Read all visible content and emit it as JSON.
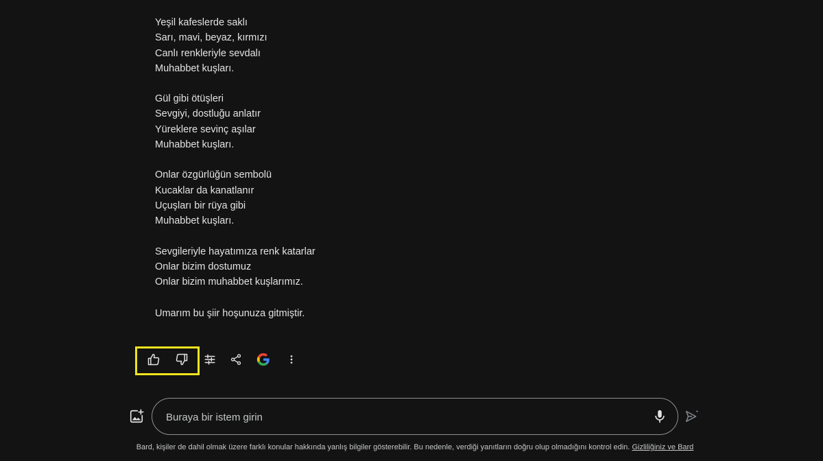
{
  "poem": {
    "stanzas": [
      [
        "Yeşil kafeslerde saklı",
        "Sarı, mavi, beyaz, kırmızı",
        "Canlı renkleriyle sevdalı",
        "Muhabbet kuşları."
      ],
      [
        "Gül gibi ötüşleri",
        "Sevgiyi, dostluğu anlatır",
        "Yüreklere sevinç aşılar",
        "Muhabbet kuşları."
      ],
      [
        "Onlar özgürlüğün sembolü",
        "Kucaklar da kanatlanır",
        "Uçuşları bir rüya gibi",
        "Muhabbet kuşları."
      ],
      [
        "Sevgileriyle hayatımıza renk katarlar",
        "Onlar bizim dostumuz",
        "Onlar bizim muhabbet kuşlarımız."
      ]
    ],
    "closing": "Umarım bu şiir hoşunuza gitmiştir."
  },
  "actions": {
    "icons": [
      "thumbs-up-icon",
      "thumbs-down-icon",
      "tune-icon",
      "share-icon",
      "google-icon",
      "more-vert-icon"
    ],
    "highlight_color": "#f0e41c"
  },
  "input": {
    "placeholder": "Buraya bir istem girin",
    "value": ""
  },
  "footer": {
    "disclaimer": "Bard, kişiler de dahil olmak üzere farklı konular hakkında yanlış bilgiler gösterebilir. Bu nedenle, verdiği yanıtların doğru olup olmadığını kontrol edin.",
    "privacy_link": "Gizliliğiniz ve Bard"
  },
  "colors": {
    "background": "#131314",
    "text": "#e3e3e3",
    "muted": "#c4c7c5",
    "border": "#8e918f"
  }
}
